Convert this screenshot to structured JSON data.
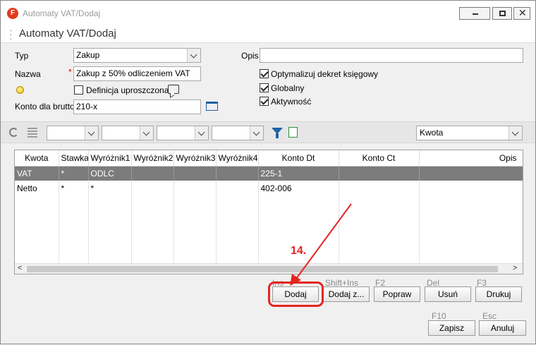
{
  "window": {
    "title": "Automaty VAT/Dodaj"
  },
  "page": {
    "title": "Automaty VAT/Dodaj"
  },
  "form": {
    "typ_label": "Typ",
    "typ_value": "Zakup",
    "nazwa_label": "Nazwa",
    "nazwa_value": "Zakup z 50% odliczeniem VAT",
    "definicja_label": "Definicja uproszczona",
    "definicja_checked": false,
    "konto_label": "Konto dla brutto",
    "konto_value": "210-x",
    "opis_label": "Opis",
    "opis_value": "",
    "optymalizuj_label": "Optymalizuj dekret księgowy",
    "optymalizuj_checked": true,
    "globalny_label": "Globalny",
    "globalny_checked": true,
    "aktywnosc_label": "Aktywność",
    "aktywnosc_checked": true
  },
  "toolbar": {
    "column_select": "Kwota"
  },
  "table": {
    "columns": [
      "Kwota",
      "Stawka",
      "Wyróżnik1",
      "Wyróżnik2",
      "Wyróżnik3",
      "Wyróżnik4",
      "Konto Dt",
      "Konto Ct",
      "Opis"
    ],
    "rows": [
      {
        "selected": true,
        "cells": [
          "VAT",
          "*",
          "ODLC",
          "",
          "",
          "",
          "225-1",
          "",
          ""
        ]
      },
      {
        "selected": false,
        "cells": [
          "Netto",
          "*",
          "*",
          "",
          "",
          "",
          "402-006",
          "",
          ""
        ]
      }
    ]
  },
  "actions": {
    "dodaj": {
      "label": "Dodaj",
      "shortcut": "Ins"
    },
    "dodaj_z": {
      "label": "Dodaj z...",
      "shortcut": "Shift+Ins"
    },
    "popraw": {
      "label": "Popraw",
      "shortcut": "F2"
    },
    "usun": {
      "label": "Usuń",
      "shortcut": "Del"
    },
    "drukuj": {
      "label": "Drukuj",
      "shortcut": "F3"
    },
    "zapisz": {
      "label": "Zapisz",
      "shortcut": "F10"
    },
    "anuluj": {
      "label": "Anuluj",
      "shortcut": "Esc"
    }
  },
  "annotation": {
    "step": "14."
  },
  "colors": {
    "annotation": "#e52521",
    "selected_row": "#7c7c7c"
  }
}
